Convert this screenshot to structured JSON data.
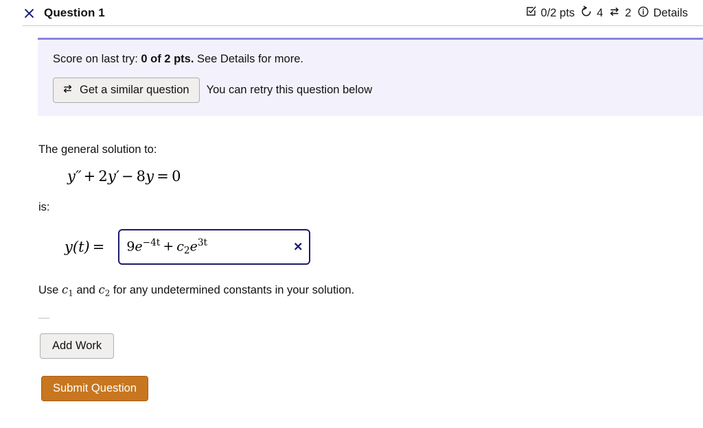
{
  "header": {
    "close_icon": "close-x-icon",
    "title": "Question 1",
    "score_icon": "checkbox-check-icon",
    "score_label": "0/2 pts",
    "attempts_icon": "undo-circular-arrow-icon",
    "attempts_count": "4",
    "similar_icon": "swap-arrows-icon",
    "similar_count": "2",
    "info_icon": "info-circle-icon",
    "details_label": "Details"
  },
  "banner": {
    "score_prefix": "Score on last try: ",
    "score_bold": "0 of 2 pts.",
    "score_suffix": " See Details for more.",
    "similar_button_icon": "swap-arrows-icon",
    "similar_button_label": "Get a similar question",
    "retry_note": "You can retry this question below",
    "accent_color": "#8b82e0",
    "background_color": "#f3f2fc"
  },
  "question": {
    "prompt": "The general solution to:",
    "equation": {
      "lhs_var": "y",
      "primes_second": "′′",
      "term2_coef": "2",
      "term2_var": "y",
      "primes_first": "′",
      "op_plus": "+",
      "op_minus": "−",
      "term3_coef": "8",
      "term3_var": "y",
      "equals": "=",
      "rhs": "0",
      "full_text": "y′′ + 2y′ − 8y = 0"
    },
    "is_label": "is:",
    "answer_label_fn": "y",
    "answer_label_arg": "(t)",
    "answer_label_eq": "=",
    "answer_value_text": "9e⁻⁴ᵗ + c₂e³ᵗ",
    "answer_parts": {
      "c1": "9",
      "e1": "e",
      "exp1": "−4t",
      "plus": "+",
      "c2": "c",
      "c2sub": "2",
      "e2": "e",
      "exp2": "3t"
    },
    "clear_icon": "clear-x-icon",
    "hint_prefix": "Use ",
    "hint_c1": "c",
    "hint_c1_sub": "1",
    "hint_mid": " and ",
    "hint_c2": "c",
    "hint_c2_sub": "2",
    "hint_suffix": " for any undetermined constants in your solution.",
    "input_border_color": "#1b1b6b"
  },
  "actions": {
    "add_work_label": "Add Work",
    "submit_label": "Submit Question",
    "submit_color": "#c8761f"
  }
}
